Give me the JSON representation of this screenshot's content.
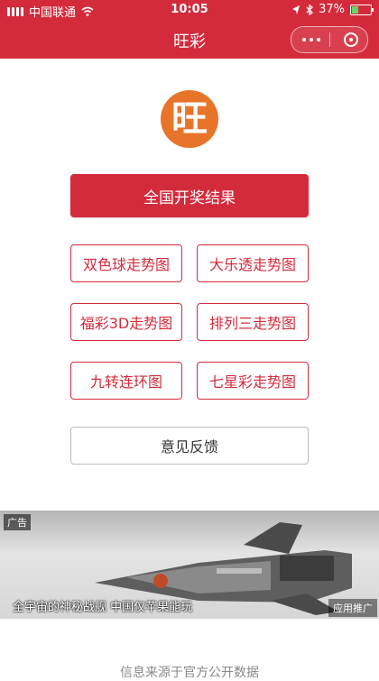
{
  "status_bar": {
    "carrier": "中国联通",
    "time": "10:05",
    "battery_percent": "37%",
    "battery_level": 0.37,
    "icons": [
      "signal-icon",
      "wifi-icon",
      "location-icon",
      "bluetooth-icon",
      "battery-icon"
    ]
  },
  "nav_bar": {
    "title": "旺彩",
    "capsule_icons": [
      "more-dots-icon",
      "close-circle-icon"
    ]
  },
  "logo": {
    "text": "旺"
  },
  "main": {
    "primary_button": "全国开奖结果",
    "grid_buttons": [
      "双色球走势图",
      "大乐透走势图",
      "福彩3D走势图",
      "排列三走势图",
      "九转连环图",
      "七星彩走势图"
    ],
    "feedback_button": "意见反馈"
  },
  "ad": {
    "tag": "广告",
    "caption": "全宇宙的神秘战舰 中国仅苹果能玩",
    "app_label": "应用推广"
  },
  "footer": {
    "text": "信息来源于官方公开数据"
  },
  "colors": {
    "brand_red": "#d42b3c",
    "logo_orange": "#e8742a",
    "feedback_border": "#bbbbbb"
  }
}
